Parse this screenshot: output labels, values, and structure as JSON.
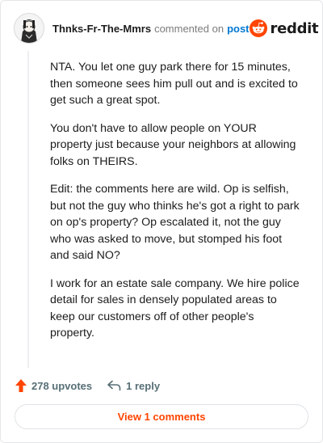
{
  "header": {
    "username": "Thnks-Fr-The-Mmrs",
    "commented_text": "commented on",
    "post_link": "post",
    "logo_text": "reddit"
  },
  "comment": {
    "paragraphs": [
      "NTA. You let one guy park there for 15 minutes, then someone sees him pull out and is excited to get such a great spot.",
      "You don't have to allow people on YOUR property just because your neighbors at allowing folks on THEIRS.",
      "Edit: the comments here are wild. Op is selfish, but not the guy who thinks he's got a right to park on op's property? Op escalated it, not the guy who was asked to move, but stomped his foot and said NO?",
      "I work for an estate sale company. We hire police detail for sales in densely populated areas to keep our customers off of other people's property."
    ]
  },
  "actions": {
    "upvotes": "278 upvotes",
    "reply": "1 reply"
  },
  "view_button": "View 1 comments",
  "colors": {
    "accent": "#ff4500",
    "link": "#0079d3"
  },
  "icons": {
    "upvote": "upvote-arrow-icon",
    "reply": "reply-arrow-icon",
    "logo": "reddit-snoo-icon"
  }
}
